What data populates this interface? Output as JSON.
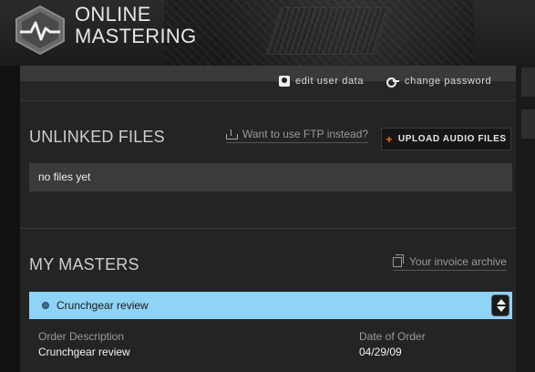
{
  "brand": {
    "line1": "ONLINE",
    "line2": "MASTERING"
  },
  "user_links": {
    "edit": "edit user data",
    "password": "change password"
  },
  "unlinked": {
    "title": "UNLINKED FILES",
    "ftp_link": "Want to use FTP instead?",
    "upload_button": "UPLOAD AUDIO FILES",
    "upload_plus": "+",
    "empty_text": "no files yet"
  },
  "masters": {
    "title": "MY MASTERS",
    "invoice_link": "Your invoice archive",
    "items": [
      {
        "title": "Crunchgear review",
        "order_description_label": "Order Description",
        "order_description": "Crunchgear review",
        "date_label": "Date of Order",
        "date": "04/29/09"
      }
    ]
  },
  "colors": {
    "accent": "#ff6a00",
    "selected_row": "#8fd3f7",
    "panel": "#262626"
  }
}
